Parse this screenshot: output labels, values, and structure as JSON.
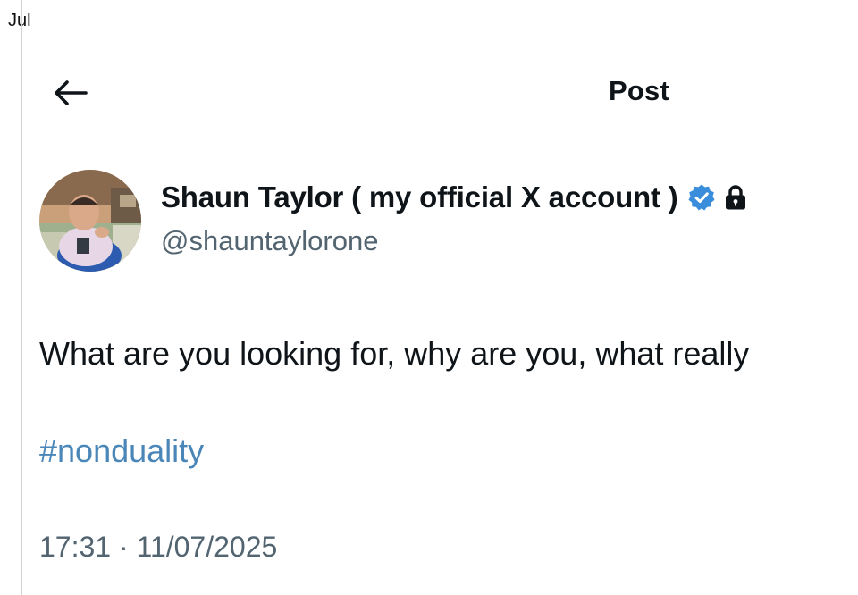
{
  "side_label": "Jul",
  "header": {
    "title": "Post",
    "back_icon": "arrow-left-icon"
  },
  "author": {
    "display_name": "Shaun Taylor ( my official X account )",
    "handle": "@shauntaylorone",
    "verified_icon": "verified-badge-icon",
    "protected_icon": "lock-icon",
    "badge_color": "#3a8ddb"
  },
  "post": {
    "text": "What are you looking for, why are you, what really",
    "hashtag": "#nonduality",
    "time": "17:31",
    "separator": "·",
    "date": "11/07/2025"
  },
  "colors": {
    "link": "#4a86b8",
    "muted": "#536471",
    "text": "#0f1419"
  }
}
